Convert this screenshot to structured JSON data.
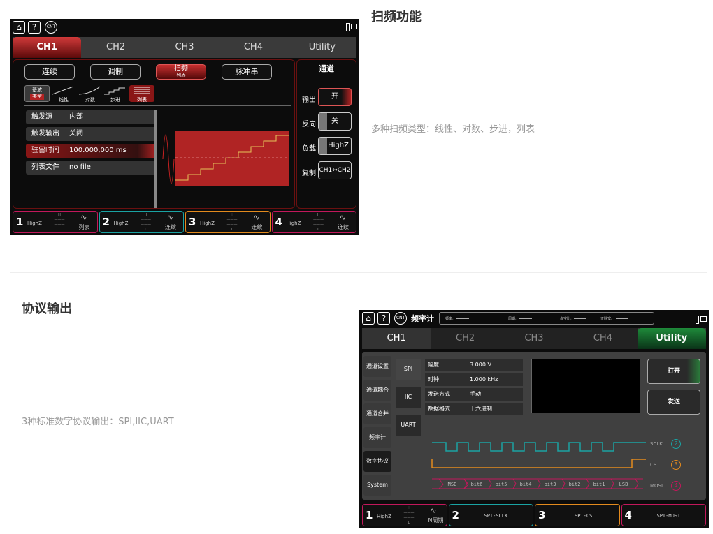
{
  "section1": {
    "heading": "扫频功能",
    "desc": "多种扫频类型：线性、对数、步进，列表",
    "topbar": {
      "home": "⌂",
      "help": "?",
      "cnt": "CNT"
    },
    "tabs": [
      "CH1",
      "CH2",
      "CH3",
      "CH4",
      "Utility"
    ],
    "modes": [
      "连续",
      "调制",
      "扫频",
      "脉冲串"
    ],
    "sweep_sub": "列表",
    "sweep_types": {
      "base": "基波",
      "base_sub": "类型",
      "items": [
        "线性",
        "对数",
        "步进",
        "列表"
      ]
    },
    "params": [
      {
        "k": "触发源",
        "v": "内部"
      },
      {
        "k": "触发输出",
        "v": "关闭"
      },
      {
        "k": "驻留时间",
        "v": "100.000,000 ms"
      },
      {
        "k": "列表文件",
        "v": "no file"
      }
    ],
    "right": {
      "title": "通道",
      "output_label": "输出",
      "output_val": "开",
      "invert_label": "反向",
      "invert_val": "关",
      "load_label": "负载",
      "load_val": "HighZ",
      "copy_label": "复制",
      "copy_val": "CH1↔CH2"
    },
    "channels": [
      {
        "num": "1",
        "hz": "HighZ",
        "mode": "列表",
        "color": "#c2185b"
      },
      {
        "num": "2",
        "hz": "HighZ",
        "mode": "连续",
        "color": "#1aa3a3"
      },
      {
        "num": "3",
        "hz": "HighZ",
        "mode": "连续",
        "color": "#e38a1d"
      },
      {
        "num": "4",
        "hz": "HighZ",
        "mode": "连续",
        "color": "#c2185b"
      }
    ]
  },
  "section2": {
    "heading": "协议输出",
    "desc": "3种标准数字协议输出：SPI,IIC,UART",
    "title": "频率计",
    "meas": {
      "freq": "频率:",
      "period": "周期:",
      "duty": "占空比:",
      "pos": "正脉宽:"
    },
    "tabs": [
      "CH1",
      "CH2",
      "CH3",
      "CH4",
      "Utility"
    ],
    "side": [
      "通道设置",
      "通道耦合",
      "通道合并",
      "频率计",
      "数字协议",
      "System"
    ],
    "protocols": [
      "SPI",
      "IIC",
      "UART"
    ],
    "params": [
      {
        "k": "幅度",
        "v": "3.000 V"
      },
      {
        "k": "时钟",
        "v": "1.000 kHz"
      },
      {
        "k": "发送方式",
        "v": "手动"
      },
      {
        "k": "数据格式",
        "v": "十六进制"
      }
    ],
    "buttons": {
      "open": "打开",
      "send": "发送"
    },
    "signals": [
      {
        "name": "SCLK",
        "num": "2",
        "color": "#1aa3a3"
      },
      {
        "name": "CS",
        "num": "3",
        "color": "#e38a1d"
      },
      {
        "name": "MOSI",
        "num": "4",
        "color": "#c2185b"
      }
    ],
    "bits": [
      "MSB",
      "bit6",
      "bit5",
      "bit4",
      "bit3",
      "bit2",
      "bit1",
      "LSB"
    ],
    "channels": [
      {
        "num": "1",
        "hz": "HighZ",
        "mode": "N周期"
      },
      {
        "num": "2",
        "label": "SPI-SCLK"
      },
      {
        "num": "3",
        "label": "SPI-CS"
      },
      {
        "num": "4",
        "label": "SPI-MOSI"
      }
    ]
  }
}
